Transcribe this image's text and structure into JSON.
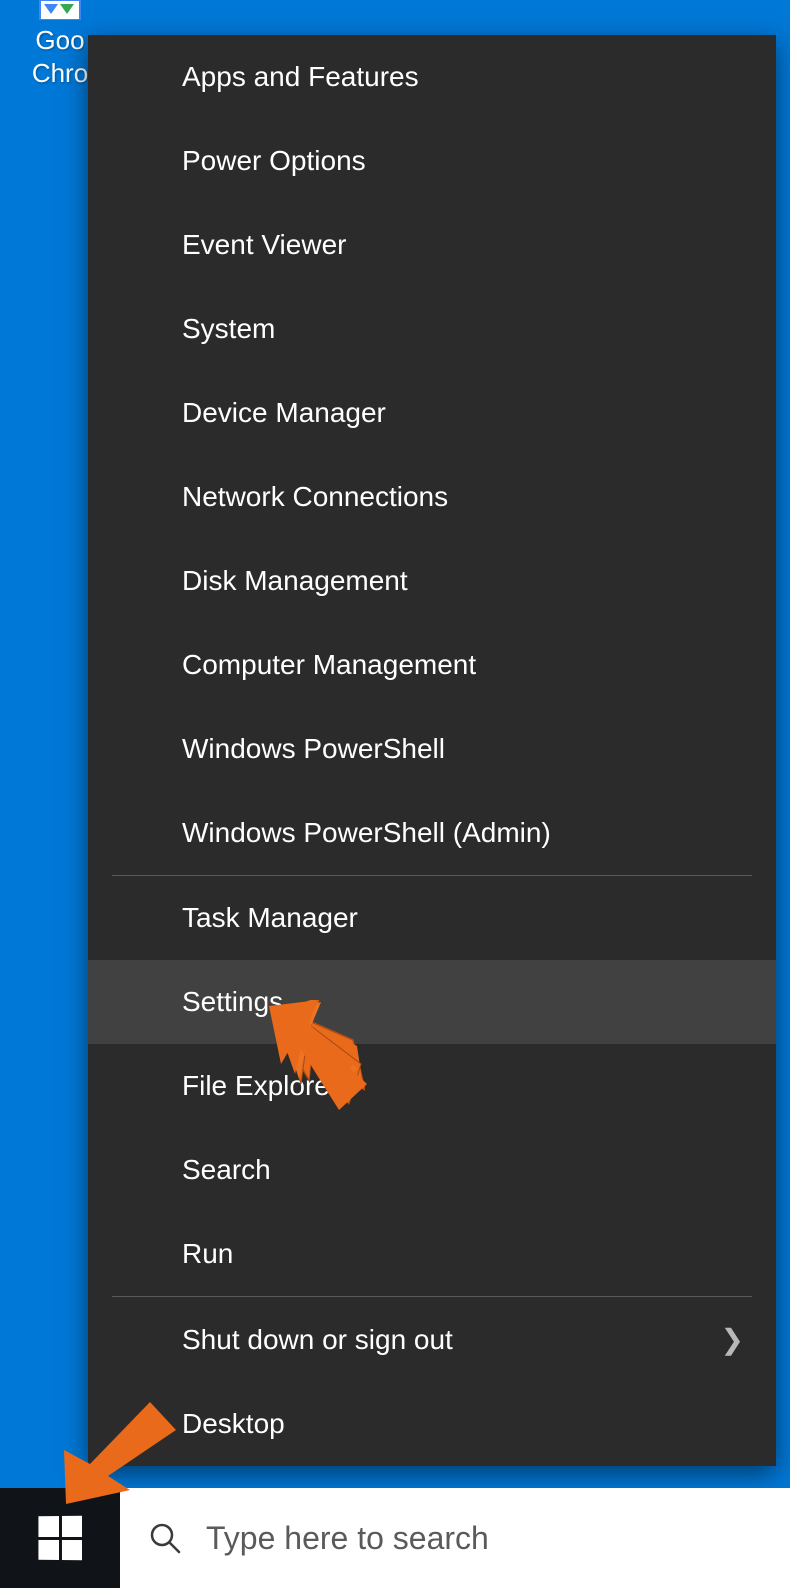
{
  "desktop": {
    "icon_label": "Google Chrome",
    "icon_label_line1": "Goo",
    "icon_label_line2": "Chro"
  },
  "menu": {
    "section1": [
      {
        "label": "Apps and Features"
      },
      {
        "label": "Power Options"
      },
      {
        "label": "Event Viewer"
      },
      {
        "label": "System"
      },
      {
        "label": "Device Manager"
      },
      {
        "label": "Network Connections"
      },
      {
        "label": "Disk Management"
      },
      {
        "label": "Computer Management"
      },
      {
        "label": "Windows PowerShell"
      },
      {
        "label": "Windows PowerShell (Admin)"
      }
    ],
    "section2": [
      {
        "label": "Task Manager"
      },
      {
        "label": "Settings",
        "hover": true
      },
      {
        "label": "File Explorer"
      },
      {
        "label": "Search"
      },
      {
        "label": "Run"
      }
    ],
    "section3": [
      {
        "label": "Shut down or sign out",
        "submenu": true
      },
      {
        "label": "Desktop"
      }
    ]
  },
  "taskbar": {
    "search_placeholder": "Type here to search"
  },
  "colors": {
    "desktop_bg": "#0078d7",
    "menu_bg": "#2b2b2b",
    "menu_hover": "#414141",
    "taskbar_bg": "#101318",
    "arrow_color": "#e86a1a"
  }
}
